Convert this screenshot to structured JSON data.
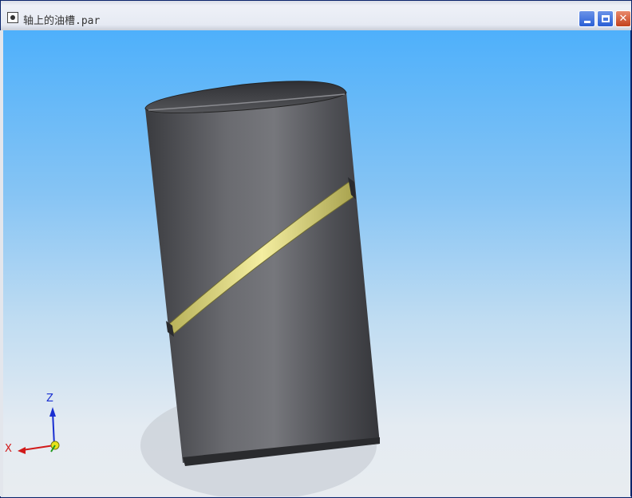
{
  "window": {
    "title": "轴上的油槽.par",
    "app_icon": "document-icon",
    "controls": {
      "minimize": "minimize-icon",
      "maximize": "maximize-icon",
      "close": "close-icon"
    }
  },
  "viewport": {
    "background_top": "#4eb0fb",
    "background_bottom": "#e8ecf0",
    "model": {
      "body_color": "#4a4b50",
      "groove_color": "#d8d27a"
    },
    "triad": {
      "z_label": "Z",
      "x_label": "X",
      "z_color": "#1a2fd1",
      "x_color": "#d11a1a",
      "origin_color": "#e8e21a"
    }
  }
}
